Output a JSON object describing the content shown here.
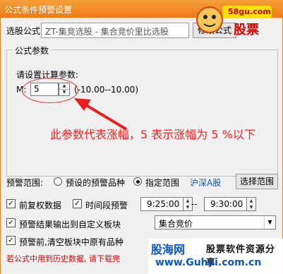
{
  "window": {
    "title": "公式条件预警设置"
  },
  "formula": {
    "label": "选股公式",
    "value": "ZT-集竞选股 - 集合竞价里比选股",
    "button": "修改公式"
  },
  "params": {
    "group_title": "公式参数",
    "prompt": "请设置计算参数:",
    "name": "M:",
    "value": "5",
    "range": "(-10.00--10.00)"
  },
  "annotation": {
    "text": "此参数代表涨幅，5 表示涨幅为 5 %以下"
  },
  "range": {
    "label": "预警范围:",
    "option_preset": "预设的预警品种",
    "option_custom": "指定范围",
    "market": "沪深A股",
    "select_button": "选择范围"
  },
  "options": {
    "prev_adj": "前复权数据",
    "time_window": "时间段预警",
    "time_start": "9:25:00",
    "time_sep": "--",
    "time_end": "9:30:00",
    "export_block": "预警结果输出到自定义板块",
    "block_value": "集合竞价",
    "clear_block": "预警前,清空板块中原有品种"
  },
  "footer": {
    "warning": "若公式中用到历史数据, 请下载完"
  },
  "watermark": {
    "brand": "股海网",
    "slogan": "股票软件资源分享",
    "url": "www.Guhai.com.cn"
  },
  "logo": {
    "site": "58gu.com",
    "text": "股票"
  },
  "colors": {
    "titlebar": "#ee7a16",
    "annotation": "#ff2020",
    "link": "#0a57c2"
  }
}
